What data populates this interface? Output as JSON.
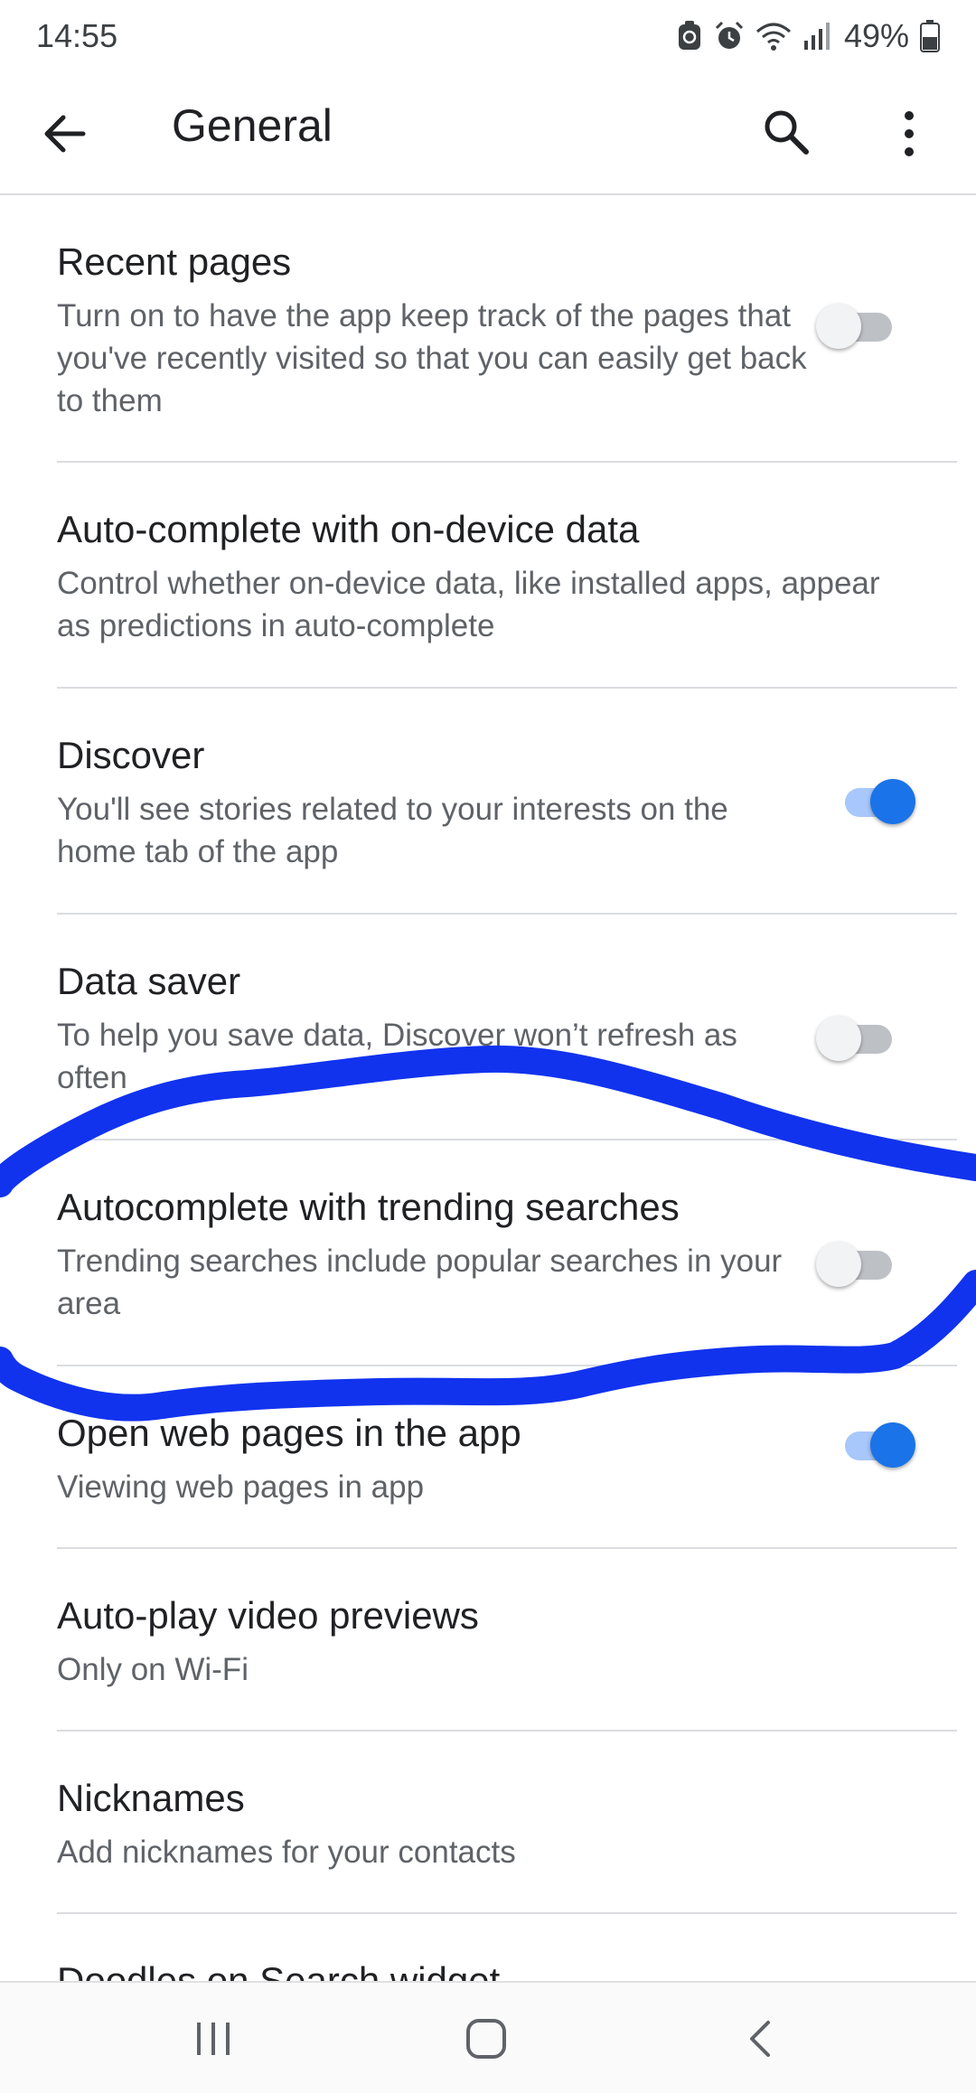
{
  "status_bar": {
    "time": "14:55",
    "battery_percent": "49%",
    "icons": [
      "recycle-notification-icon",
      "alarm-icon",
      "wifi-icon",
      "signal-icon",
      "battery-icon"
    ]
  },
  "app_bar": {
    "title": "General",
    "back_icon": "arrow-back-icon",
    "search_icon": "search-icon",
    "more_icon": "more-vert-icon"
  },
  "settings": [
    {
      "title": "Recent pages",
      "subtitle": "Turn on to have the app keep track of the pages that you've recently visited so that you can easily get back to them",
      "toggle": "off"
    },
    {
      "title": "Auto-complete with on-device data",
      "subtitle": "Control whether on-device data, like installed apps, appear as predictions in auto-complete",
      "toggle": null
    },
    {
      "title": "Discover",
      "subtitle": "You'll see stories related to your interests on the home tab of the app",
      "toggle": "on"
    },
    {
      "title": "Data saver",
      "subtitle": "To help you save data, Discover won’t refresh as often",
      "toggle": "off"
    },
    {
      "title": "Autocomplete with trending searches",
      "subtitle": "Trending searches include popular searches in your area",
      "toggle": "off"
    },
    {
      "title": "Open web pages in the app",
      "subtitle": "Viewing web pages in app",
      "toggle": "on"
    },
    {
      "title": "Auto-play video previews",
      "subtitle": "Only on Wi-Fi",
      "toggle": null
    },
    {
      "title": "Nicknames",
      "subtitle": "Add nicknames for your contacts",
      "toggle": null
    },
    {
      "title": "Doodles on Search widget",
      "subtitle": "",
      "toggle": null
    }
  ],
  "colors": {
    "accent": "#1a73e8",
    "annotation_stroke": "#1133ee"
  },
  "nav_bar": {
    "icons": [
      "recents-icon",
      "home-icon",
      "back-icon"
    ]
  }
}
